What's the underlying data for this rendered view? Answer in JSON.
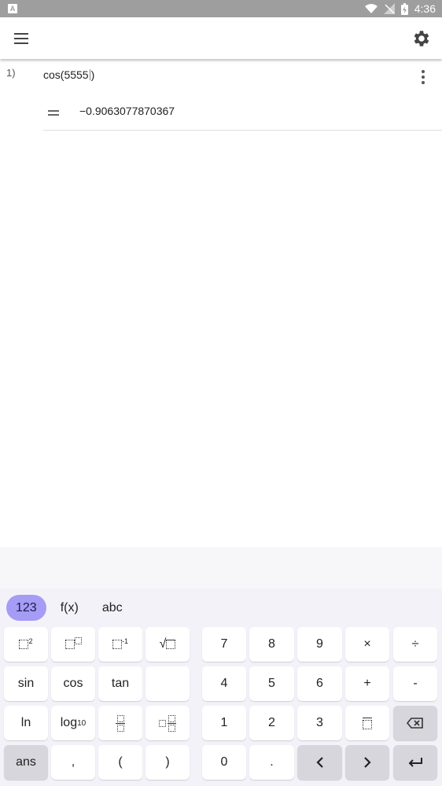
{
  "status_bar": {
    "time": "4:36",
    "app_badge": "A"
  },
  "worksheet": {
    "line_number": "1)",
    "input_before_caret": "cos(5555",
    "input_after_caret": ")",
    "result": "−0.9063077870367"
  },
  "keyboard": {
    "tabs": [
      "123",
      "f(x)",
      "abc"
    ],
    "active_tab": "123",
    "keys": {
      "sin": "sin",
      "cos": "cos",
      "tan": "tan",
      "ln": "ln",
      "log": "log",
      "log_sub": "10",
      "ans": "ans",
      "comma": ",",
      "lparen": "(",
      "rparen": ")",
      "n7": "7",
      "n8": "8",
      "n9": "9",
      "times": "×",
      "divide": "÷",
      "n4": "4",
      "n5": "5",
      "n6": "6",
      "plus": "+",
      "minus": "-",
      "n1": "1",
      "n2": "2",
      "n3": "3",
      "n0": "0",
      "dot": ".",
      "left": "<",
      "right": ">",
      "sq_exp": "2",
      "inv_exp": "-1"
    }
  },
  "colors": {
    "accent": "#a59cf5",
    "status_bar": "#9e9e9e",
    "keyboard_bg": "#f3f2f8"
  }
}
